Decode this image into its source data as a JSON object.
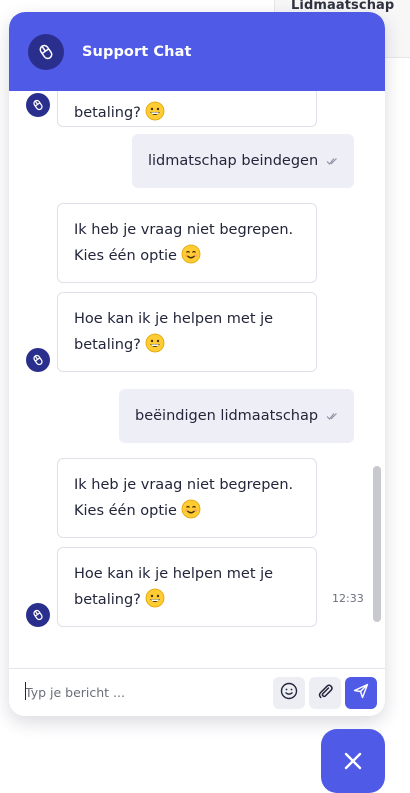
{
  "background_page": {
    "tab_label": "Lidmaatschap"
  },
  "header": {
    "title": "Support Chat",
    "avatar_icon": "mouse-icon"
  },
  "messages": [
    {
      "sender": "bot",
      "text_line1": "betaling?",
      "emoji": "grin"
    },
    {
      "sender": "user",
      "text": "lidmatschap beindegen",
      "status_icon": "double-check-icon"
    },
    {
      "sender": "bot",
      "text_line1": "Ik heb je vraag niet begrepen.",
      "text_line2": "Kies één optie",
      "emoji": "smile"
    },
    {
      "sender": "bot",
      "text_line1": "Hoe kan ik je helpen met je",
      "text_line2": "betaling?",
      "emoji": "grin"
    },
    {
      "sender": "user",
      "text": "beëindigen lidmaatschap",
      "status_icon": "double-check-icon"
    },
    {
      "sender": "bot",
      "text_line1": "Ik heb je vraag niet begrepen.",
      "text_line2": "Kies één optie",
      "emoji": "smile"
    },
    {
      "sender": "bot",
      "text_line1": "Hoe kan ik je helpen met je",
      "text_line2": "betaling?",
      "emoji": "grin",
      "time": "12:33"
    }
  ],
  "composer": {
    "placeholder": "Typ je bericht ...",
    "value": "",
    "emoji_icon": "smiley-icon",
    "attach_icon": "paperclip-icon",
    "send_icon": "send-icon"
  },
  "launcher": {
    "icon": "close-icon"
  },
  "colors": {
    "accent": "#4f5ae6",
    "avatar": "#2a2f8e",
    "user_bubble": "#eeeff6",
    "bot_border": "#dfe1ea"
  }
}
